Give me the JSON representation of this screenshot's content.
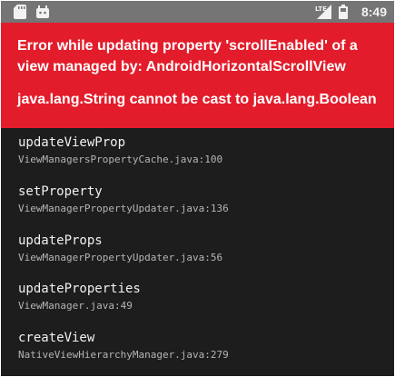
{
  "status_bar": {
    "time": "8:49",
    "left_icons": [
      "sd-card-icon",
      "android-debug-icon"
    ],
    "right_icons": [
      "signal-icon",
      "battery-icon"
    ]
  },
  "error": {
    "line1": "Error while updating property 'scrollEnabled' of a",
    "line2": "view managed by: AndroidHorizontalScrollView",
    "line3": "java.lang.String cannot be cast to java.lang.Boolean"
  },
  "stack_frames": [
    {
      "method": "updateViewProp",
      "location": "ViewManagersPropertyCache.java:100"
    },
    {
      "method": "setProperty",
      "location": "ViewManagerPropertyUpdater.java:136"
    },
    {
      "method": "updateProps",
      "location": "ViewManagerPropertyUpdater.java:56"
    },
    {
      "method": "updateProperties",
      "location": "ViewManager.java:49"
    },
    {
      "method": "createView",
      "location": "NativeViewHierarchyManager.java:279"
    }
  ],
  "colors": {
    "status_bar": "#757575",
    "error_banner": "#e31c2b",
    "background": "#1d1d1d"
  }
}
